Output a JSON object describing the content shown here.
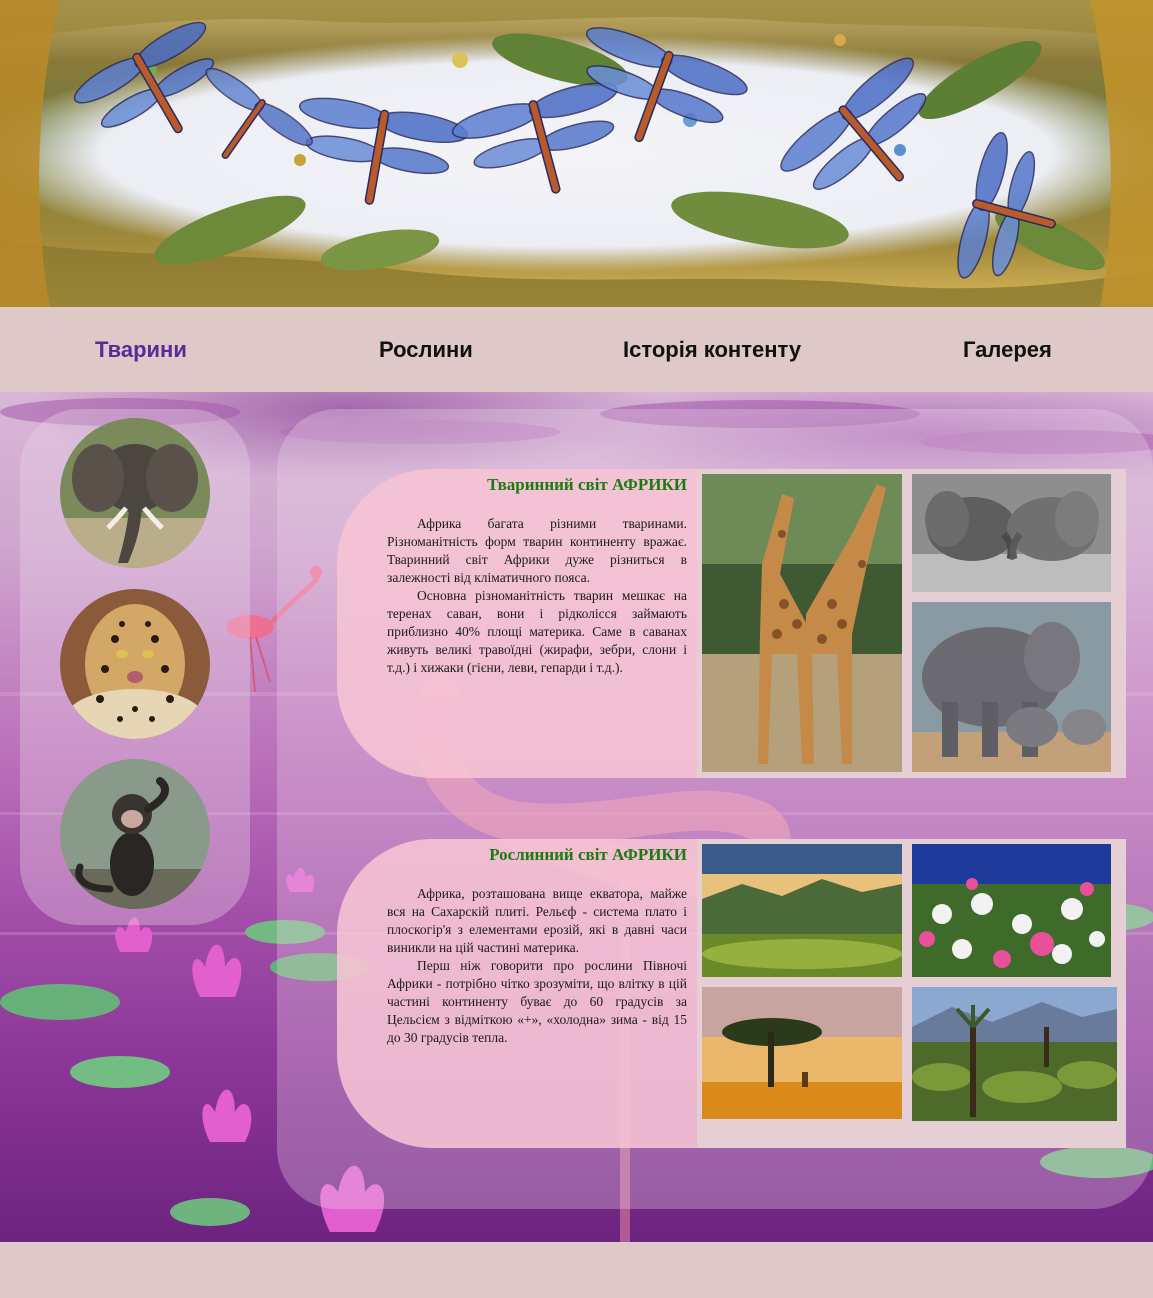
{
  "nav": {
    "items": [
      {
        "label": "Тварини",
        "active": true
      },
      {
        "label": "Рослини",
        "active": false
      },
      {
        "label": "Історія контенту",
        "active": false
      },
      {
        "label": "Галерея",
        "active": false
      }
    ]
  },
  "sidebar": {
    "avatars": [
      "elephant-icon",
      "leopard-icon",
      "baboon-icon"
    ]
  },
  "animals": {
    "title": "Тваринний світ АФРИКИ",
    "paragraphs": [
      "Африка багата різними тваринами. Різноманітність форм тварин континенту вражає. Тваринний світ Африки дуже різниться в залежності від кліматичного пояса.",
      "Основна різноманітність тварин мешкає на теренах саван, вони і рідколісся займають приблизно 40% площі материка. Саме в саванах живуть великі травоїдні (жирафи, зебри, слони і т.д.) і хижаки (гієни, леви, гепарди і т.д.)."
    ]
  },
  "plants": {
    "title": "Рослинний світ АФРИКИ",
    "paragraphs": [
      "Африка, розташована вище екватора, майже вся на Сахарскій плиті. Рельєф - система плато і плоскогір'я з елементами ерозій, які в давні часи виникли на цій частині материка.",
      "Перш ніж говорити про рослини Півночі Африки - потрібно чітко зрозуміти, що влітку в цій частині континенту буває до 60 градусів за Цельсієм з відміткою «+», «холодна» зима - від 15 до 30 градусів тепла."
    ]
  },
  "colors": {
    "nav_active": "#5a2a96",
    "section_title": "#1c7a12",
    "page_bg": "#dfc8c8"
  }
}
